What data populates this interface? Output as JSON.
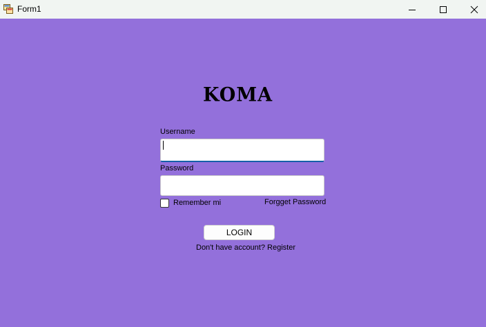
{
  "window": {
    "title": "Form1",
    "background": "#9370DB",
    "controls": [
      "minimize-icon",
      "maximize-icon",
      "close-icon"
    ]
  },
  "login": {
    "logo_text": "KOMA",
    "username_label": "Username",
    "username_value": "",
    "password_label": "Password",
    "password_value": "",
    "remember_label": "Remember mi",
    "remember_checked": false,
    "forgot_label": "Forgget Password",
    "login_button": "LOGIN",
    "register_prompt": "Don't have account?",
    "register_link": "Register"
  }
}
